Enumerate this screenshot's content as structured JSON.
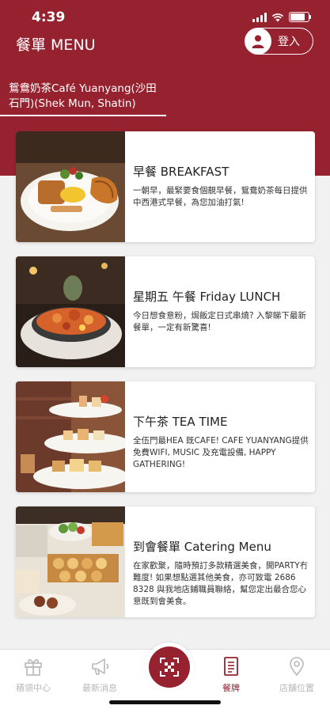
{
  "status": {
    "time": "4:39"
  },
  "header": {
    "title": "餐單 MENU",
    "login_label": "登入",
    "store_name": "鴛鴦奶茶Café Yuanyang(沙田石門)(Shek Mun, Shatin)"
  },
  "menu": [
    {
      "title": "早餐 BREAKFAST",
      "desc": "一朝早，最緊要食個靚早餐，鴛鴦奶茶每日提供中西港式早餐，為您加油打氣!"
    },
    {
      "title": "星期五 午餐 Friday LUNCH",
      "desc": "今日想食意粉，焗飯定日式串燒? 入黎睇下最新餐單，一定有新驚喜!"
    },
    {
      "title": "下午茶 TEA TIME",
      "desc": "全伍門最HEA 既CAFE! CAFE YUANYANG提供免費WIFI, MUSIC 及充電設備, HAPPY GATHERING!"
    },
    {
      "title": "到會餐單 Catering Menu",
      "desc": "在家歡聚，隨時預訂多款精選美食，開PARTY冇難度! 如果想點選其他美食，亦可致電 2686 8328 與我地店鋪職員聯絡，幫您定出最合您心意既到會美食。"
    }
  ],
  "tabs": [
    {
      "label": "積領中心",
      "icon": "gift-icon"
    },
    {
      "label": "最新消息",
      "icon": "megaphone-icon"
    },
    {
      "label": "餐牌",
      "icon": "menu-icon"
    },
    {
      "label": "店舖位置",
      "icon": "location-icon"
    }
  ],
  "colors": {
    "brand": "#96222f",
    "background": "#f2f1f1",
    "inactive_tab": "#b8b8b8"
  }
}
